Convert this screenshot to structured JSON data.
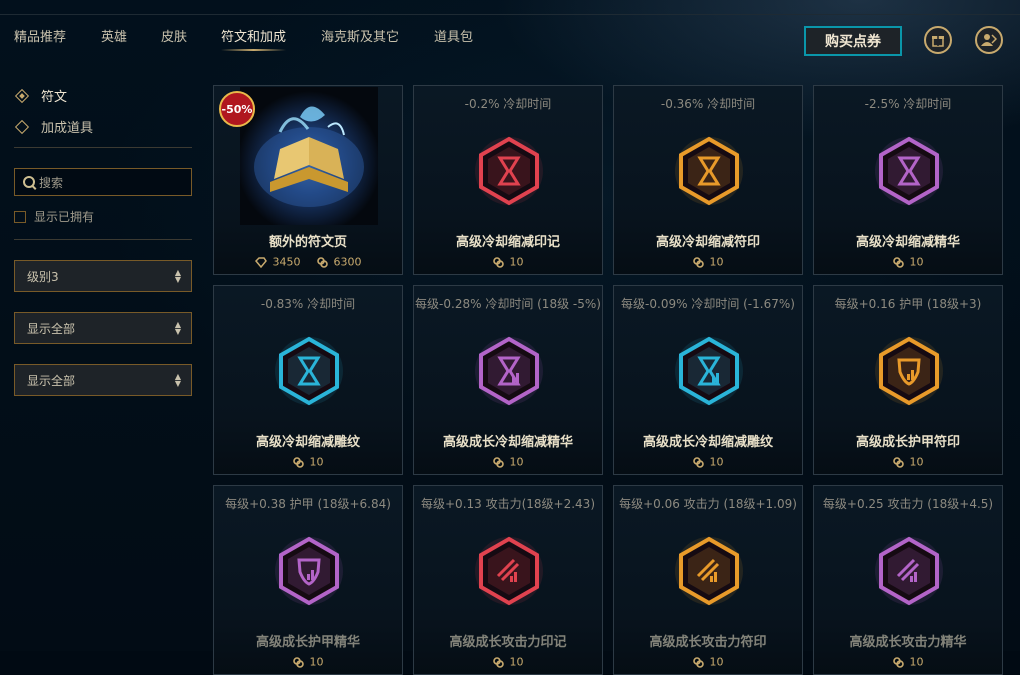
{
  "nav": {
    "tabs": [
      {
        "label": "精品推荐"
      },
      {
        "label": "英雄"
      },
      {
        "label": "皮肤"
      },
      {
        "label": "符文和加成",
        "active": true
      },
      {
        "label": "海克斯及其它"
      },
      {
        "label": "道具包"
      }
    ],
    "buy_label": "购买点券",
    "gift_icon": "gift-icon",
    "account_icon": "account-icon"
  },
  "sidebar": {
    "categories": [
      {
        "label": "符文",
        "selected": true
      },
      {
        "label": "加成道具",
        "selected": false
      }
    ],
    "search_placeholder": "搜索",
    "show_owned_label": "显示已拥有",
    "filters": [
      "级别3",
      "显示全部",
      "显示全部"
    ]
  },
  "colors": {
    "gold": "#c8aa6e",
    "accent": "#0a96aa",
    "red": "#e0424f",
    "orange": "#e89a2a",
    "purple": "#b364c8",
    "cyan": "#2ab4d8"
  },
  "cards": [
    {
      "stat": "",
      "name": "额外的符文页",
      "discount": "-50%",
      "ip": "3450",
      "rp": "6300",
      "icon": "spell-book-icon",
      "type": "book"
    },
    {
      "stat": "-0.2% 冷却时间",
      "name": "高级冷却缩减印记",
      "rp": "10",
      "icon": "hourglass-icon",
      "color": "red"
    },
    {
      "stat": "-0.36% 冷却时间",
      "name": "高级冷却缩减符印",
      "rp": "10",
      "icon": "hourglass-icon",
      "color": "orange"
    },
    {
      "stat": "-2.5% 冷却时间",
      "name": "高级冷却缩减精华",
      "rp": "10",
      "icon": "hourglass-icon",
      "color": "purple"
    },
    {
      "stat": "-0.83% 冷却时间",
      "name": "高级冷却缩减雕纹",
      "rp": "10",
      "icon": "hourglass-icon",
      "color": "cyan"
    },
    {
      "stat": "每级-0.28% 冷却时间 (18级 -5%)",
      "name": "高级成长冷却缩减精华",
      "rp": "10",
      "icon": "hourglass-scaling-icon",
      "color": "purple"
    },
    {
      "stat": "每级-0.09% 冷却时间 (-1.67%)",
      "name": "高级成长冷却缩减雕纹",
      "rp": "10",
      "icon": "hourglass-scaling-icon",
      "color": "cyan"
    },
    {
      "stat": "每级+0.16 护甲 (18级+3)",
      "name": "高级成长护甲符印",
      "rp": "10",
      "icon": "armor-scaling-icon",
      "color": "orange"
    },
    {
      "stat": "每级+0.38 护甲 (18级+6.84)",
      "name": "高级成长护甲精华",
      "rp": "10",
      "icon": "armor-scaling-icon",
      "color": "purple"
    },
    {
      "stat": "每级+0.13 攻击力(18级+2.43)",
      "name": "高级成长攻击力印记",
      "rp": "10",
      "icon": "attack-scaling-icon",
      "color": "red"
    },
    {
      "stat": "每级+0.06 攻击力 (18级+1.09)",
      "name": "高级成长攻击力符印",
      "rp": "10",
      "icon": "attack-scaling-icon",
      "color": "orange"
    },
    {
      "stat": "每级+0.25 攻击力 (18级+4.5)",
      "name": "高级成长攻击力精华",
      "rp": "10",
      "icon": "attack-scaling-icon",
      "color": "purple"
    }
  ]
}
